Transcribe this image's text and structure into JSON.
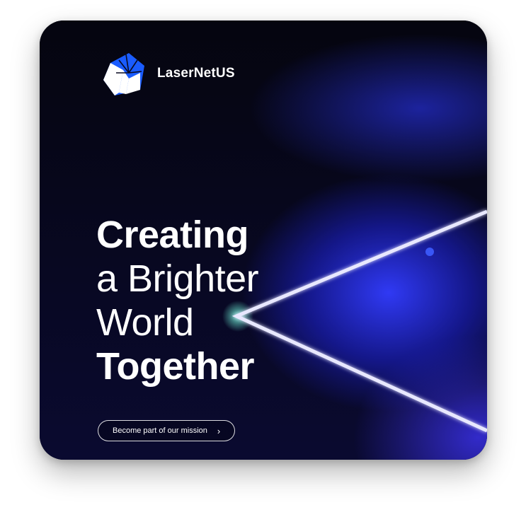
{
  "brand": {
    "name": "LaserNetUS",
    "accent": "#1a5cff"
  },
  "hero": {
    "line1": "Creating",
    "line2": "a Brighter",
    "line3": "World",
    "line4": "Together"
  },
  "cta": {
    "label": "Become part of our mission",
    "icon": "chevron-right-icon"
  },
  "colors": {
    "background": "#05050f",
    "glow": "#2f3cff",
    "text": "#ffffff"
  }
}
